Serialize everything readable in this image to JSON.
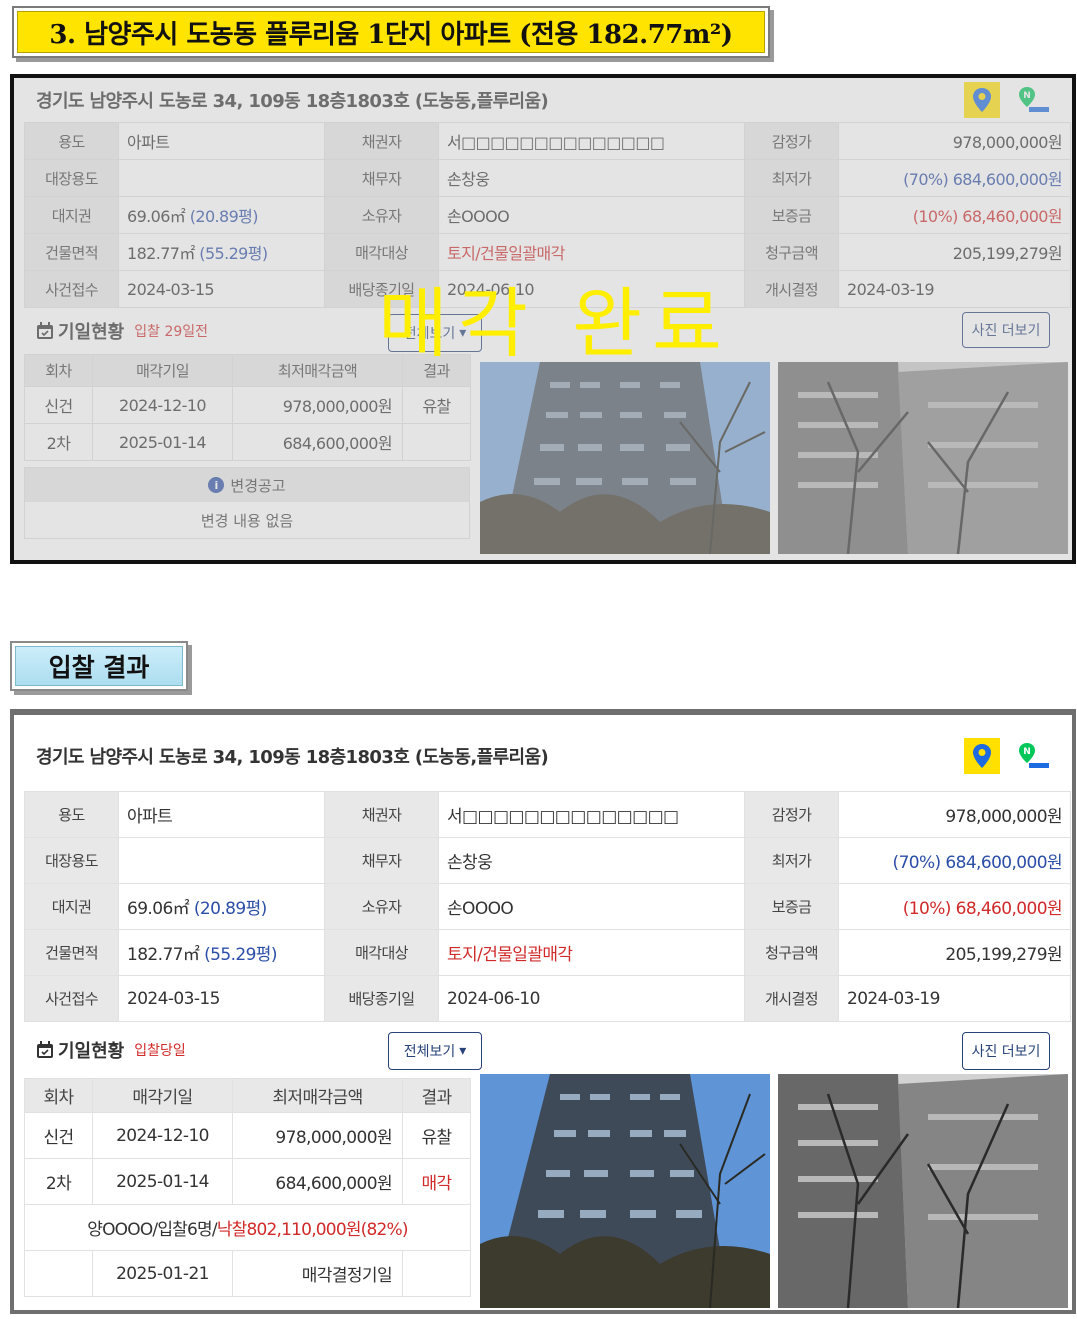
{
  "header": {
    "title": "3. 남양주시 도농동 플루리움 1단지 아파트 (전용 182.77m²)"
  },
  "result_header": {
    "title": "입찰 결과"
  },
  "property": {
    "address": "경기도 남양주시 도농로 34, 109동 18층1803호 (도농동,플루리움)",
    "labels": {
      "use": "용도",
      "register_use": "대장용도",
      "land_right": "대지권",
      "building_area": "건물면적",
      "case_received": "사건접수",
      "creditor": "채권자",
      "debtor": "채무자",
      "owner": "소유자",
      "sale_target": "매각대상",
      "dividend_deadline": "배당종기일",
      "appraisal": "감정가",
      "minimum": "최저가",
      "deposit": "보증금",
      "claim": "청구금액",
      "commencement": "개시결정"
    },
    "values": {
      "use": "아파트",
      "register_use": "",
      "land_right": "69.06㎡",
      "land_right_pyeong": "(20.89평)",
      "building_area": "182.77㎡",
      "building_area_pyeong": "(55.29평)",
      "case_received": "2024-03-15",
      "creditor": "서□□□□□□□□□□□□□□",
      "debtor": "손창웅",
      "owner": "손OOOO",
      "sale_target": "토지/건물일괄매각",
      "dividend_deadline": "2024-06-10",
      "appraisal": "978,000,000원",
      "minimum_pct": "(70%)",
      "minimum": "684,600,000원",
      "deposit_pct": "(10%)",
      "deposit": "68,460,000원",
      "claim": "205,199,279원",
      "commencement": "2024-03-19"
    }
  },
  "schedule": {
    "title": "기일현황",
    "badge_top": "입찰 29일전",
    "badge_bottom": "입찰당일",
    "view_all": "전체보기",
    "more_photos": "사진 더보기",
    "columns": [
      "회차",
      "매각기일",
      "최저매각금액",
      "결과"
    ],
    "rows": [
      {
        "round": "신건",
        "date": "2024-12-10",
        "amount": "978,000,000원",
        "result": "유찰"
      },
      {
        "round": "2차",
        "date": "2025-01-14",
        "amount": "684,600,000원",
        "result": "매각"
      }
    ],
    "winning_bid": {
      "bidder": "양OOOO/입찰6명/",
      "amount": "낙찰802,110,000원(82%)"
    },
    "decision": {
      "date": "2025-01-21",
      "label": "매각결정기일"
    }
  },
  "notice": {
    "title": "변경공고",
    "body": "변경 내용 없음"
  },
  "overlay": {
    "text": "매각 완료"
  },
  "colors": {
    "banner_yellow": "#ffe400",
    "banner_blue": "#b8e4f4",
    "link_blue": "#2c4ea8",
    "alert_red": "#d12a2a",
    "stamp": "#ffee00"
  },
  "icons": {
    "kakao_map": "map-pin-icon",
    "naver_map": "naver-map-icon",
    "calendar": "calendar-icon",
    "info": "info-icon"
  }
}
